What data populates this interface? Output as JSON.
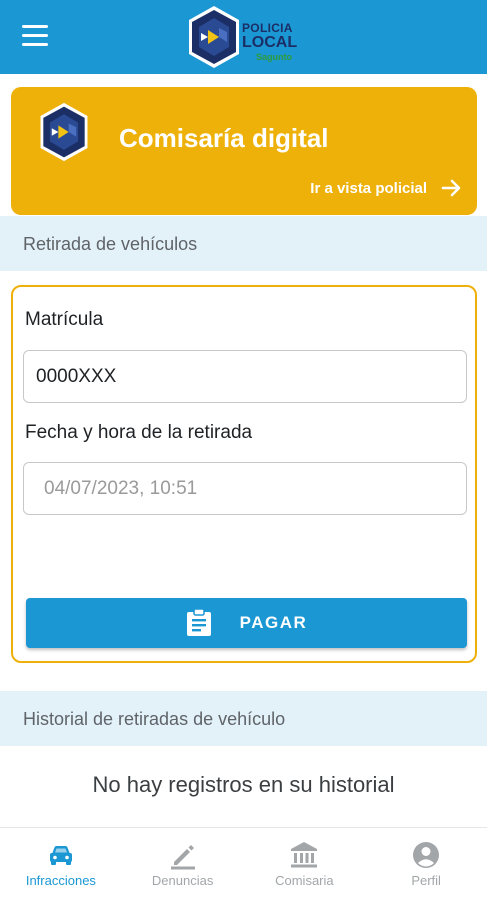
{
  "header": {
    "menu_icon": "hamburger-menu-icon",
    "logo": {
      "line1": "POLICIA",
      "line2": "LOCAL",
      "line3": "Sagunto",
      "colors": {
        "navy": "#1b2f66",
        "yellow": "#f2c314",
        "green": "#2e9b3c"
      }
    }
  },
  "banner": {
    "title": "Comisaría digital",
    "link_label": "Ir a vista policial",
    "link_icon": "arrow-right-icon",
    "background": "#eeb10a"
  },
  "section_retirada": {
    "title": "Retirada de vehículos"
  },
  "form": {
    "plate_label": "Matrícula",
    "plate_value": "0000XXX",
    "datetime_label": "Fecha y hora de la retirada",
    "datetime_placeholder": "04/07/2023, 10:51",
    "pay_button_label": "PAGAR",
    "pay_button_icon": "clipboard-icon"
  },
  "section_historial": {
    "title": "Historial de retiradas de vehículo",
    "empty_message": "No hay registros en su historial"
  },
  "bottom_nav": {
    "items": [
      {
        "label": "Infracciones",
        "icon": "car-icon",
        "active": true
      },
      {
        "label": "Denuncias",
        "icon": "pencil-icon",
        "active": false
      },
      {
        "label": "Comisaria",
        "icon": "bank-icon",
        "active": false
      },
      {
        "label": "Perfil",
        "icon": "account-circle-icon",
        "active": false
      }
    ]
  },
  "colors": {
    "primary": "#1b97d3",
    "accent": "#eeb10a",
    "section_bg": "#e3f1f9",
    "inactive": "#a2a6a9"
  }
}
